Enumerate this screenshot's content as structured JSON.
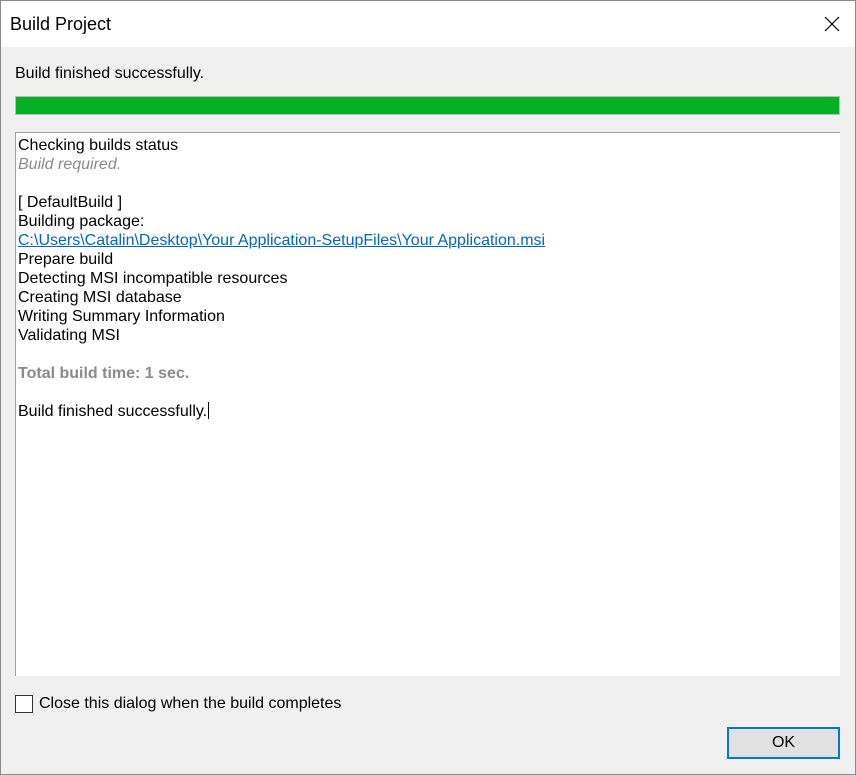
{
  "window": {
    "title": "Build Project",
    "close_icon": "close-icon"
  },
  "status": {
    "text": "Build finished successfully.",
    "progress_percent": 100,
    "progress_color": "#06b025"
  },
  "log": {
    "lines": [
      {
        "text": "Checking builds status",
        "style": "normal"
      },
      {
        "text": "Build required.",
        "style": "italic"
      },
      {
        "text": "",
        "style": "normal"
      },
      {
        "text": "[ DefaultBuild ]",
        "style": "normal"
      },
      {
        "text": "Building package:",
        "style": "normal"
      },
      {
        "text": "C:\\Users\\Catalin\\Desktop\\Your Application-SetupFiles\\Your Application.msi",
        "style": "link"
      },
      {
        "text": "Prepare build",
        "style": "normal"
      },
      {
        "text": "Detecting MSI incompatible resources",
        "style": "normal"
      },
      {
        "text": "Creating MSI database",
        "style": "normal"
      },
      {
        "text": "Writing Summary Information",
        "style": "normal"
      },
      {
        "text": "Validating MSI",
        "style": "normal"
      },
      {
        "text": "",
        "style": "normal"
      },
      {
        "text": "Total build time: 1 sec.",
        "style": "bold-gray"
      },
      {
        "text": "",
        "style": "normal"
      },
      {
        "text": "Build finished successfully.",
        "style": "normal",
        "caret": true
      }
    ]
  },
  "footer": {
    "close_on_complete_label": "Close this dialog when the build completes",
    "close_on_complete_checked": false,
    "ok_label": "OK"
  }
}
